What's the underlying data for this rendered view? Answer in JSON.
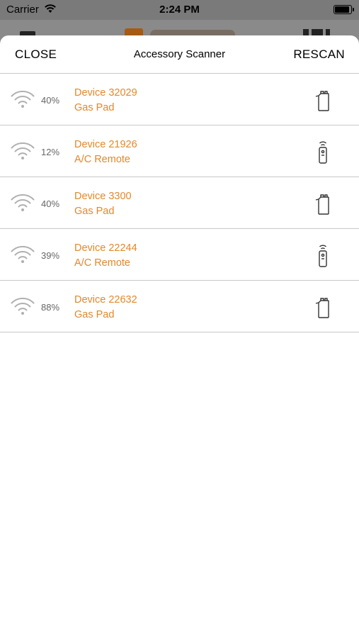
{
  "status_bar": {
    "carrier": "Carrier",
    "time": "2:24 PM",
    "battery_level": 1.0
  },
  "nav": {
    "close_label": "CLOSE",
    "title": "Accessory Scanner",
    "rescan_label": "RESCAN"
  },
  "devices": [
    {
      "signal": "40%",
      "name": "Device 32029",
      "type": "Gas Pad",
      "icon": "gas-pad-icon"
    },
    {
      "signal": "12%",
      "name": "Device 21926",
      "type": "A/C Remote",
      "icon": "ac-remote-icon"
    },
    {
      "signal": "40%",
      "name": "Device 3300",
      "type": "Gas Pad",
      "icon": "gas-pad-icon"
    },
    {
      "signal": "39%",
      "name": "Device 22244",
      "type": "A/C Remote",
      "icon": "ac-remote-icon"
    },
    {
      "signal": "88%",
      "name": "Device 22632",
      "type": "Gas Pad",
      "icon": "gas-pad-icon"
    }
  ],
  "colors": {
    "accent": "#e3882a",
    "divider": "#c8c8c8",
    "signal_gray": "#b0b0b0"
  }
}
